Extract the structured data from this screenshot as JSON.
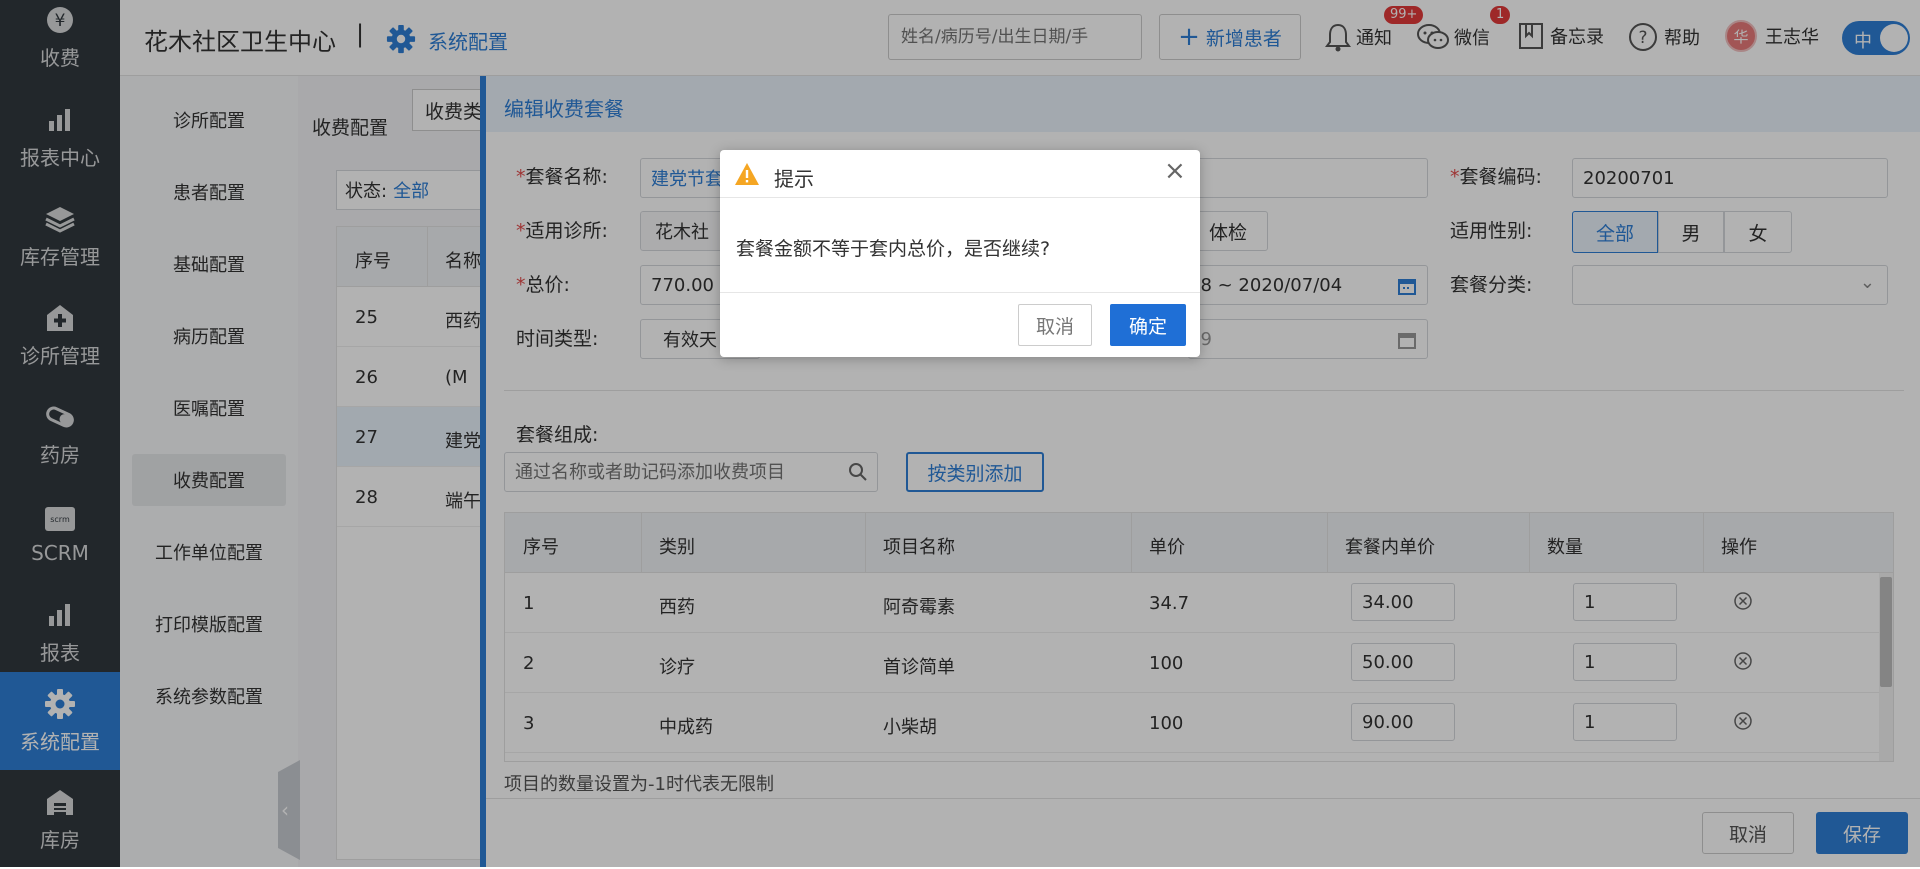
{
  "sidebar": {
    "items": [
      {
        "label": "收费",
        "icon": "yen-icon"
      },
      {
        "label": "报表中心",
        "icon": "bar-chart-icon"
      },
      {
        "label": "库存管理",
        "icon": "layers-icon"
      },
      {
        "label": "诊所管理",
        "icon": "house-plus-icon"
      },
      {
        "label": "药房",
        "icon": "pill-icon"
      },
      {
        "label": "SCRM",
        "icon": "scrm-icon"
      },
      {
        "label": "报表",
        "icon": "bar-chart-icon"
      },
      {
        "label": "系统配置",
        "icon": "gear-icon"
      },
      {
        "label": "库房",
        "icon": "warehouse-icon"
      }
    ]
  },
  "header": {
    "clinic": "花木社区卫生中心",
    "separator": "|",
    "section": "系统配置",
    "search_placeholder": "姓名/病历号/出生日期/手",
    "add_patient": "新增患者",
    "notify": "通知",
    "notify_badge": "99+",
    "wechat": "微信",
    "wechat_badge": "1",
    "memo": "备忘录",
    "help": "帮助",
    "user": "王志华",
    "avatar_char": "华",
    "lang": "中"
  },
  "submenu": {
    "items": [
      "诊所配置",
      "患者配置",
      "基础配置",
      "病历配置",
      "医嘱配置",
      "收费配置",
      "工作单位配置",
      "打印模版配置",
      "系统参数配置"
    ]
  },
  "bg": {
    "title": "收费配置",
    "tab": "收费类",
    "status_label": "状态:",
    "status_value": "全部",
    "headers": [
      "序号",
      "名称"
    ],
    "rows": [
      [
        "25",
        "西药"
      ],
      [
        "26",
        "(M"
      ],
      [
        "27",
        "建党"
      ],
      [
        "28",
        "端午"
      ]
    ]
  },
  "drawer": {
    "title": "编辑收费套餐",
    "name_label": "套餐名称:",
    "name_value": "建党节套",
    "code_label": "套餐编码:",
    "code_value": "20200701",
    "clinic_label": "适用诊所:",
    "clinic_value": "花木社",
    "exam_btn": "体检",
    "gender_label": "适用性别:",
    "gender_options": [
      "全部",
      "男",
      "女"
    ],
    "total_label": "总价:",
    "total_value": "770.00",
    "date_range": "28 ~ 2020/07/04",
    "category_label": "套餐分类:",
    "time_type_label": "时间类型:",
    "time_type_value": "有效天",
    "date_end": "09",
    "composition_label": "套餐组成:",
    "item_search_placeholder": "通过名称或者助记码添加收费项目",
    "add_by_category": "按类别添加",
    "table": {
      "headers": [
        "序号",
        "类别",
        "项目名称",
        "单价",
        "套餐内单价",
        "数量",
        "操作"
      ],
      "rows": [
        {
          "no": "1",
          "cat": "西药",
          "name": "阿奇霉素",
          "price": "34.7",
          "pkg_price": "34.00",
          "qty": "1"
        },
        {
          "no": "2",
          "cat": "诊疗",
          "name": "首诊简单",
          "price": "100",
          "pkg_price": "50.00",
          "qty": "1"
        },
        {
          "no": "3",
          "cat": "中成药",
          "name": "小柴胡",
          "price": "100",
          "pkg_price": "90.00",
          "qty": "1"
        }
      ]
    },
    "note": "项目的数量设置为-1时代表无限制",
    "cancel": "取消",
    "save": "保存"
  },
  "dialog": {
    "title": "提示",
    "message": "套餐金额不等于套内总价，是否继续?",
    "cancel": "取消",
    "confirm": "确定"
  },
  "colors": {
    "primary": "#2e7fd6",
    "sidebar": "#32383e",
    "badge": "#e23a3a",
    "warning": "#f5a623"
  }
}
